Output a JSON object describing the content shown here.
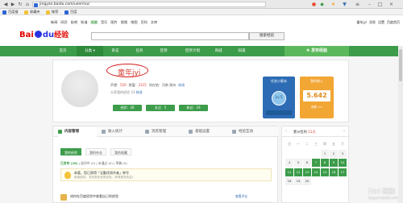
{
  "browser": {
    "url": "jingyan.baidu.com/user/nuc",
    "bookmarks": [
      "百度搜",
      "收藏夹",
      "推荐",
      "百度"
    ]
  },
  "topnav": {
    "links": [
      "新闻",
      "网页",
      "贴吧",
      "知道",
      "经验",
      "音乐",
      "图片",
      "视频",
      "地图",
      "百科",
      "文库"
    ],
    "active_index": 4,
    "user": "童年jyi",
    "user_links": [
      "消息",
      "设置",
      "百度首页"
    ]
  },
  "search": {
    "button": "搜索经验"
  },
  "greenbar": {
    "items": [
      "首页",
      "分类",
      "杂志",
      "任务",
      "签到",
      "回享计划",
      "商城",
      "知道"
    ],
    "publish": "发布经验"
  },
  "profile": {
    "username": "童年jyi",
    "stats": [
      {
        "label": "声望：",
        "value": "520"
      },
      {
        "label": "财富：",
        "value": "2315"
      },
      {
        "label": "所在地：",
        "value": "河南 郑州"
      },
      {
        "label": "",
        "value": "修改"
      }
    ],
    "signature": "分享我的经验 33",
    "signature_edit": "修改",
    "pills": [
      "经验：26",
      "关注：5",
      "粉丝：19"
    ],
    "tasks_card": {
      "title": "任务小蜜本",
      "level": "Lv.5"
    },
    "income_card": {
      "title": "我的收入",
      "value": "5.642",
      "detail": "查看 >>"
    }
  },
  "content": {
    "tabs": [
      "内容管理",
      "收入统计",
      "消息管理",
      "基础设置",
      "经验互动"
    ],
    "active_tab": 0,
    "subtabs": [
      "我的经验",
      "我的杂志",
      "我的收藏"
    ],
    "active_subtab": 0,
    "filter_label": "已发布 (26)",
    "filter_rest": "| 追问中 (0) | 未通过 (0) | 草稿 (0)",
    "notice_title": "恭喜，您已获得「全勤优质作者」称号",
    "notice_desc": "继续保持，发布更多优质经验，获得更多收益！",
    "article_title": "如何在百度经验中查看自己的经验",
    "article_status": "查看评论"
  },
  "calendar": {
    "title": "累计签到",
    "count": "11天",
    "weekdays": [
      "日",
      "一",
      "二",
      "三",
      "四",
      "五",
      "六"
    ],
    "days": [
      "",
      "",
      "",
      "",
      "1",
      "2",
      "3",
      "4",
      "5",
      "6",
      "7",
      "8",
      "9",
      "10",
      "11",
      "12",
      "13",
      "14",
      "15",
      "16",
      "17",
      "18",
      "19",
      "20"
    ],
    "done_days": [
      "7",
      "8",
      "9",
      "10",
      "11",
      "12",
      "13",
      "14",
      "15",
      "16",
      "17"
    ]
  },
  "watermark": {
    "main": "Bai 经验",
    "sub": "jingyan.baidu.com"
  },
  "colors": {
    "green": "#3c9c4a",
    "red": "#d43c31",
    "blue": "#2d6cb5",
    "orange": "#f2a634"
  }
}
